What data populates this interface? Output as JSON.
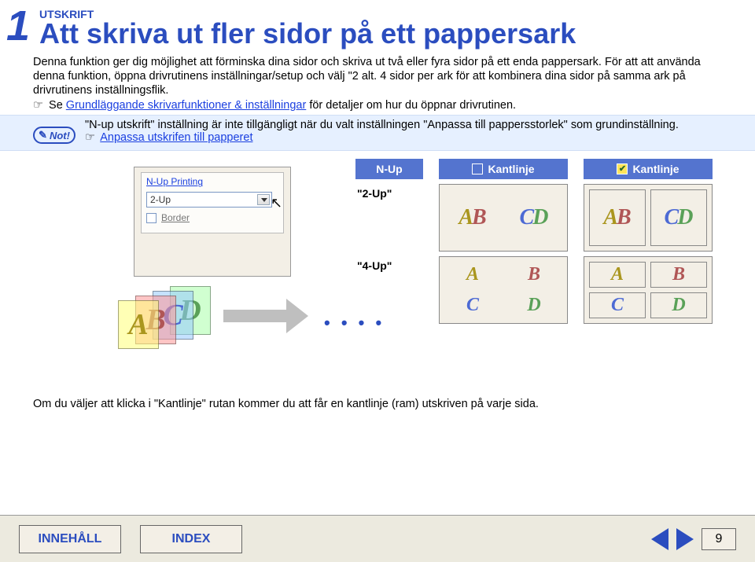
{
  "header": {
    "number": "1",
    "category": "UTSKRIFT",
    "title": "Att skriva ut fler sidor på ett pappersark"
  },
  "body_text": "Denna funktion ger dig möjlighet att förminska dina sidor och skriva ut två eller fyra sidor på ett enda pappersark. För att att använda denna funktion, öppna drivrutinens inställningar/setup och välj \"2 alt. 4 sidor per ark för att kombinera dina sidor på samma ark på drivrutinens inställningsflik.",
  "see": {
    "pre": "Se ",
    "link": "Grundläggande skrivarfunktioner & inställningar",
    "post": " för detaljer om hur du öppnar drivrutinen."
  },
  "note": {
    "badge": "Not!",
    "line1": "\"N-up utskrift\" inställning är inte tillgängligt när du valt inställningen \"Anpassa till pappersstorlek\" som grundinställning.",
    "link": "Anpassa utskrifen till papperet"
  },
  "panel": {
    "group_label": "N-Up Printing",
    "combo_value": "2-Up",
    "border_label": "Border"
  },
  "results": {
    "col1": "N-Up",
    "col2": "Kantlinje",
    "col3": "Kantlinje",
    "row1_label": "\"2-Up\"",
    "row2_label": "\"4-Up\""
  },
  "letters": {
    "a": "A",
    "b": "B",
    "c": "C",
    "d": "D"
  },
  "footer_note": "Om du väljer att klicka i \"Kantlinje\" rutan kommer du att får en kantlinje (ram) utskriven på varje sida.",
  "bottombar": {
    "contents": "INNEHÅLL",
    "index": "INDEX",
    "page": "9"
  }
}
